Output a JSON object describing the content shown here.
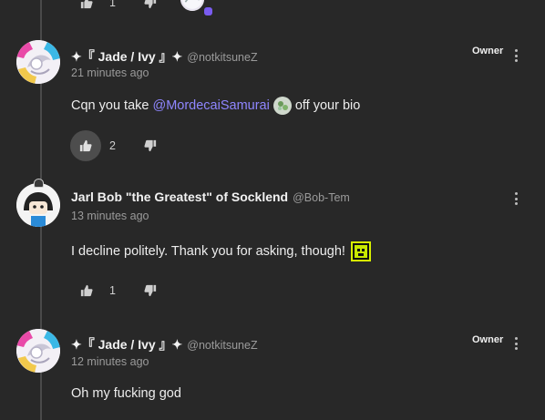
{
  "top_partial": {
    "like_count": "1"
  },
  "comments": [
    {
      "display_name": "✦『 Jade / Ivy 』✦",
      "handle": "@notkitsuneZ",
      "time": "21 minutes ago",
      "badge": "Owner",
      "text_before": "Cqn you take",
      "mention": "@MordecaiSamurai",
      "text_after": "off your bio",
      "like_count": "2"
    },
    {
      "display_name": "Jarl Bob \"the Greatest\" of Socklend",
      "handle": "@Bob-Tem",
      "time": "13 minutes ago",
      "text": "I decline politely. Thank you for asking, though!",
      "like_count": "1"
    },
    {
      "display_name": "✦『 Jade / Ivy 』✦",
      "handle": "@notkitsuneZ",
      "time": "12 minutes ago",
      "badge": "Owner",
      "text": "Oh my fucking god"
    }
  ],
  "colors": {
    "background": "#282828",
    "mention": "#8f86ff",
    "muted": "#9a9a9a",
    "active_vote": "#4d4d4d"
  }
}
